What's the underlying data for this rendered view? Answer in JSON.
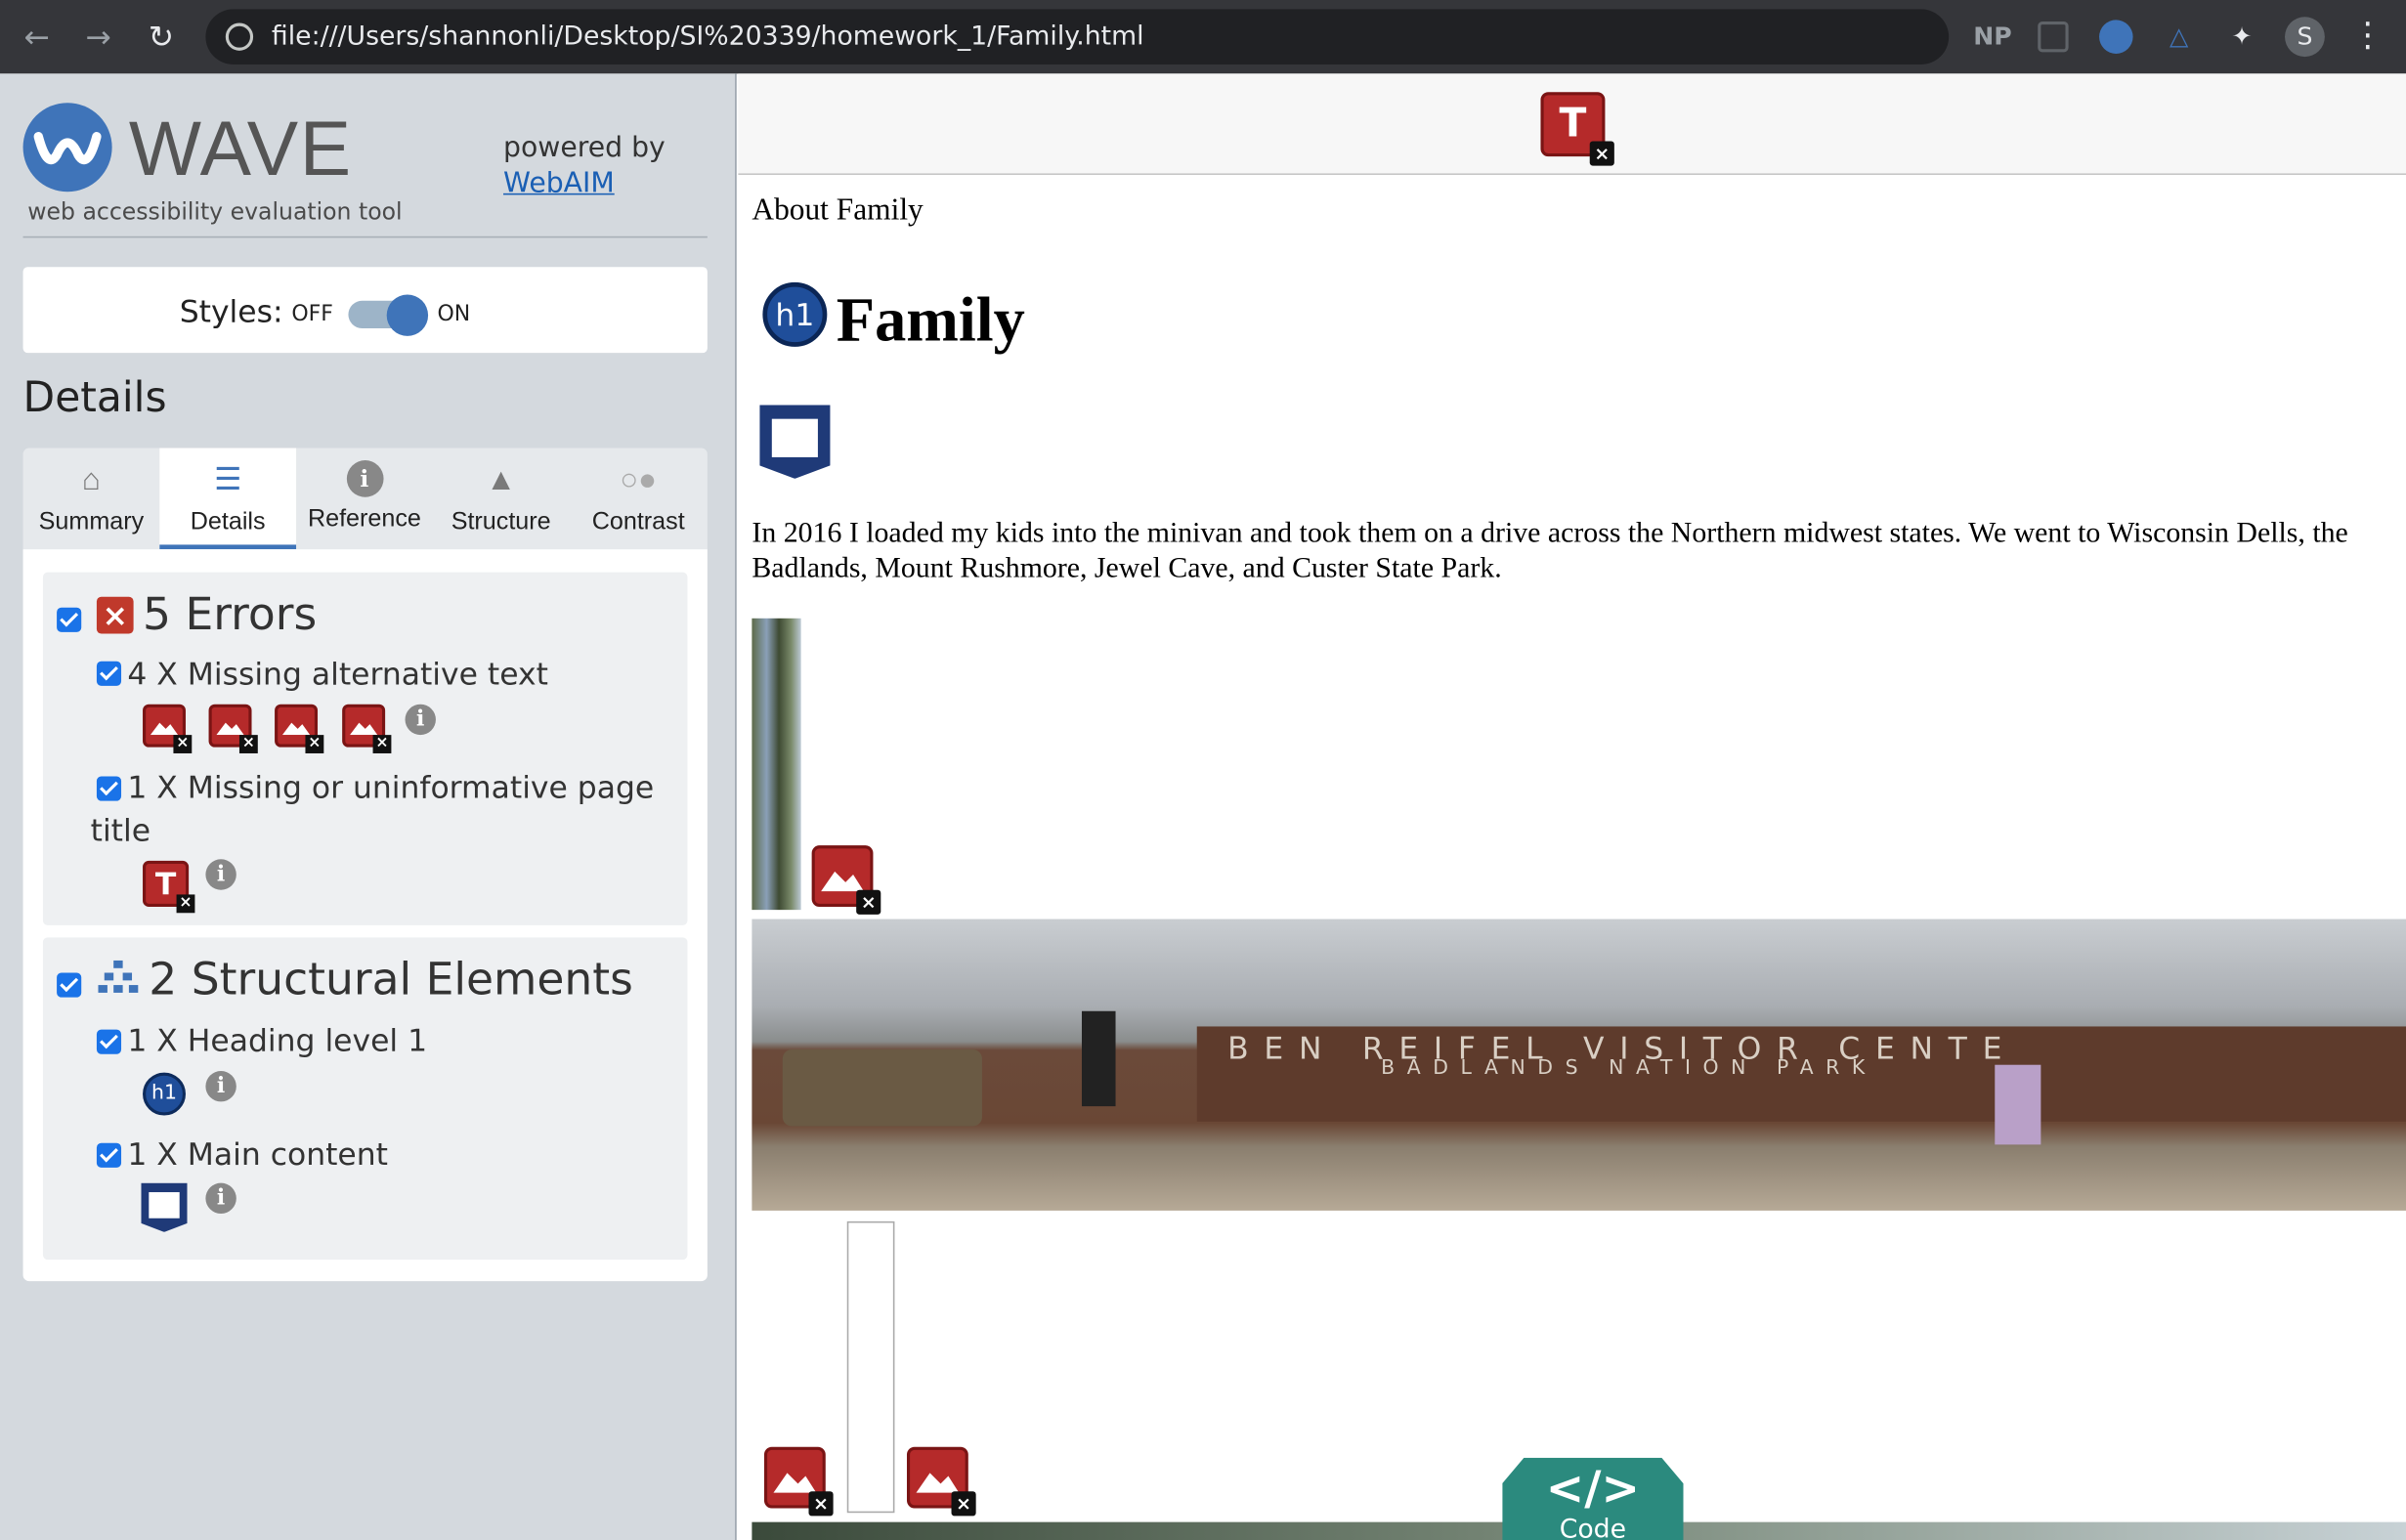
{
  "browser": {
    "url": "file:///Users/shannonli/Desktop/SI%20339/homework_1/Family.html",
    "ext_np": "NP",
    "profile_initial": "S"
  },
  "wave": {
    "name": "WAVE",
    "tagline": "web accessibility evaluation tool",
    "powered_by": "powered by",
    "webaim": "WebAIM",
    "styles_label": "Styles:",
    "off": "OFF",
    "on": "ON",
    "details_title": "Details",
    "tabs": [
      {
        "label": "Summary",
        "icon": "home-icon"
      },
      {
        "label": "Details",
        "icon": "list-icon",
        "active": true
      },
      {
        "label": "Reference",
        "icon": "info-icon"
      },
      {
        "label": "Structure",
        "icon": "hierarchy-icon"
      },
      {
        "label": "Contrast",
        "icon": "contrast-icon"
      }
    ],
    "errors": {
      "title": "5 Errors",
      "items": [
        {
          "label": "4 X Missing alternative text",
          "icon_count": 4
        },
        {
          "label": "1 X Missing or uninformative page",
          "label2": "title"
        }
      ]
    },
    "structure": {
      "title": "2 Structural Elements",
      "items": [
        {
          "label": "1 X Heading level 1"
        },
        {
          "label": "1 X Main content"
        }
      ]
    },
    "colors": {
      "accent": "#3f74b9",
      "error": "#b52a2a",
      "panel": "#d4d9de"
    }
  },
  "page": {
    "about": "About Family",
    "heading": "Family",
    "h1_badge": "h1",
    "paragraph": "In 2016 I loaded my kids into the minivan and took them on a drive across the Northern midwest states. We went to Wisconsin Dells, the Badlands, Mount Rushmore, Jewel Cave, and Custer State Park.",
    "sign_line1": "BEN REIFEL VISITOR CENTE",
    "sign_line2": "BADLANDS NATION   PARK",
    "code_button": "Code",
    "code_glyph": "</>",
    "title_badge": "T"
  }
}
